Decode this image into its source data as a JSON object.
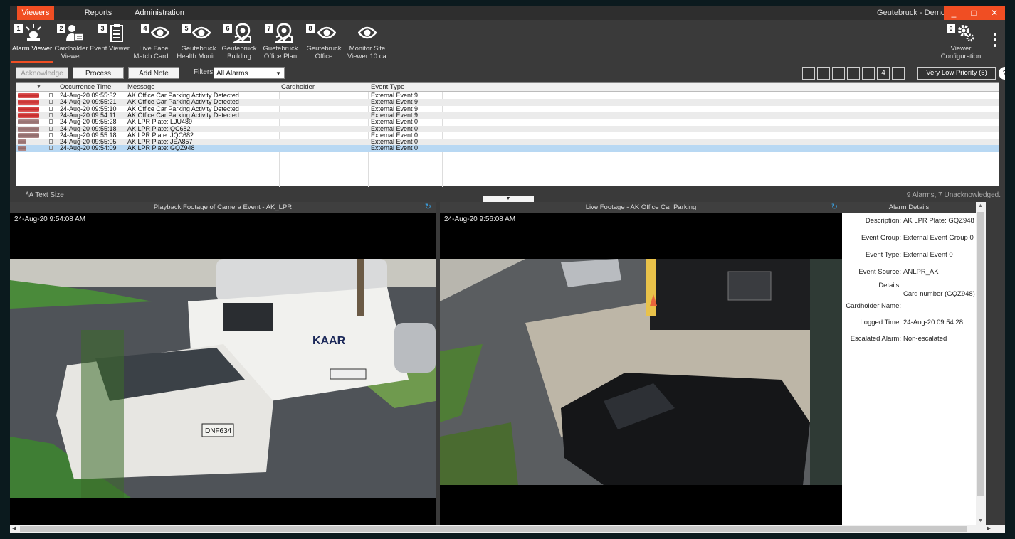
{
  "menu": {
    "viewers": "Viewers",
    "reports": "Reports",
    "administration": "Administration"
  },
  "app_title": "Geutebruck - Demo",
  "window_buttons": {
    "minimize": "_",
    "maximize": "□",
    "close": "✕"
  },
  "ribbon": [
    {
      "num": "1",
      "label1": "Alarm Viewer",
      "label2": "",
      "icon": "alarm-beacon-icon"
    },
    {
      "num": "2",
      "label1": "Cardholder",
      "label2": "Viewer",
      "icon": "cardholder-icon"
    },
    {
      "num": "3",
      "label1": "Event Viewer",
      "label2": "",
      "icon": "clipboard-icon"
    },
    {
      "num": "4",
      "label1": "Live Face",
      "label2": "Match Card...",
      "icon": "eye-icon"
    },
    {
      "num": "5",
      "label1": "Geutebruck",
      "label2": "Health Monit...",
      "icon": "eye-icon"
    },
    {
      "num": "6",
      "label1": "Geutebruck",
      "label2": "Building",
      "icon": "map-pin-icon"
    },
    {
      "num": "7",
      "label1": "Guetebruck",
      "label2": "Office Plan",
      "icon": "map-pin-icon"
    },
    {
      "num": "8",
      "label1": "Geutebruck",
      "label2": "Office",
      "icon": "eye-icon"
    },
    {
      "num": "",
      "label1": "Monitor Site",
      "label2": "Viewer 10 ca...",
      "icon": "eye-icon"
    }
  ],
  "viewer_config": {
    "num": "0",
    "label1": "Viewer",
    "label2": "Configuration"
  },
  "toolbar": {
    "acknowledge": "Acknowledge",
    "process": "Process",
    "add_note": "Add Note",
    "filters_label": "Filters:",
    "filter_value": "All Alarms",
    "priority_boxes": [
      "",
      "",
      "",
      "",
      "",
      "4",
      ""
    ],
    "priority_button": "Very Low Priority (5)",
    "help": "?"
  },
  "table": {
    "columns": {
      "occurrence": "Occurrence Time",
      "message": "Message",
      "cardholder": "Cardholder",
      "event_type": "Event Type"
    },
    "rows": [
      {
        "time": "24-Aug-20 09:55:32",
        "message": "AK Office Car Parking Activity Detected",
        "cardholder": "",
        "event_type": "External Event 9",
        "sev": "red"
      },
      {
        "time": "24-Aug-20 09:55:21",
        "message": "AK Office Car Parking Activity Detected",
        "cardholder": "",
        "event_type": "External Event 9",
        "sev": "red"
      },
      {
        "time": "24-Aug-20 09:55:10",
        "message": "AK Office Car Parking Activity Detected",
        "cardholder": "",
        "event_type": "External Event 9",
        "sev": "red"
      },
      {
        "time": "24-Aug-20 09:54:11",
        "message": "AK Office Car Parking Activity Detected",
        "cardholder": "",
        "event_type": "External Event 9",
        "sev": "red"
      },
      {
        "time": "24-Aug-20 09:55:28",
        "message": "AK LPR Plate:    LJU489",
        "cardholder": "",
        "event_type": "External Event 0",
        "sev": "grey"
      },
      {
        "time": "24-Aug-20 09:55:18",
        "message": "AK LPR Plate:    QC682",
        "cardholder": "",
        "event_type": "External Event 0",
        "sev": "grey"
      },
      {
        "time": "24-Aug-20 09:55:18",
        "message": "AK LPR Plate:    JQC682",
        "cardholder": "",
        "event_type": "External Event 0",
        "sev": "grey"
      },
      {
        "time": "24-Aug-20 09:55:05",
        "message": "AK LPR Plate:    JEA857",
        "cardholder": "",
        "event_type": "External Event 0",
        "sev": "grey"
      },
      {
        "time": "24-Aug-20 09:54:09",
        "message": "AK LPR Plate:    GQZ948",
        "cardholder": "",
        "event_type": "External Event 0",
        "sev": "grey"
      }
    ]
  },
  "status": {
    "text_size": "Text Size",
    "alarm_count": "9 Alarms, 7 Unacknowledged."
  },
  "panels": {
    "playback_title": "Playback Footage of Camera Event - AK_LPR",
    "playback_time": "24-Aug-20 9:54:08 AM",
    "live_title": "Live Footage  - AK Office Car Parking",
    "live_time": "24-Aug-20 9:56:08 AM"
  },
  "details": {
    "title": "Alarm Details",
    "fields": [
      {
        "label": "Description:",
        "value": "AK LPR Plate:    GQZ948"
      },
      {
        "label": "Event Group:",
        "value": "External Event Group 0"
      },
      {
        "label": "Event Type:",
        "value": "External Event 0"
      },
      {
        "label": "Event Source:",
        "value": "ANLPR_AK"
      },
      {
        "label": "Details:",
        "value": "Card number (GQZ948)"
      },
      {
        "label": "Cardholder Name:",
        "value": ""
      },
      {
        "label": "Logged Time:",
        "value": "24-Aug-20 09:54:28"
      },
      {
        "label": "Escalated Alarm:",
        "value": "Non-escalated"
      }
    ]
  },
  "colors": {
    "accent": "#f04e23",
    "selected_row": "#b8d8f3",
    "refresh": "#3a9bd8"
  }
}
